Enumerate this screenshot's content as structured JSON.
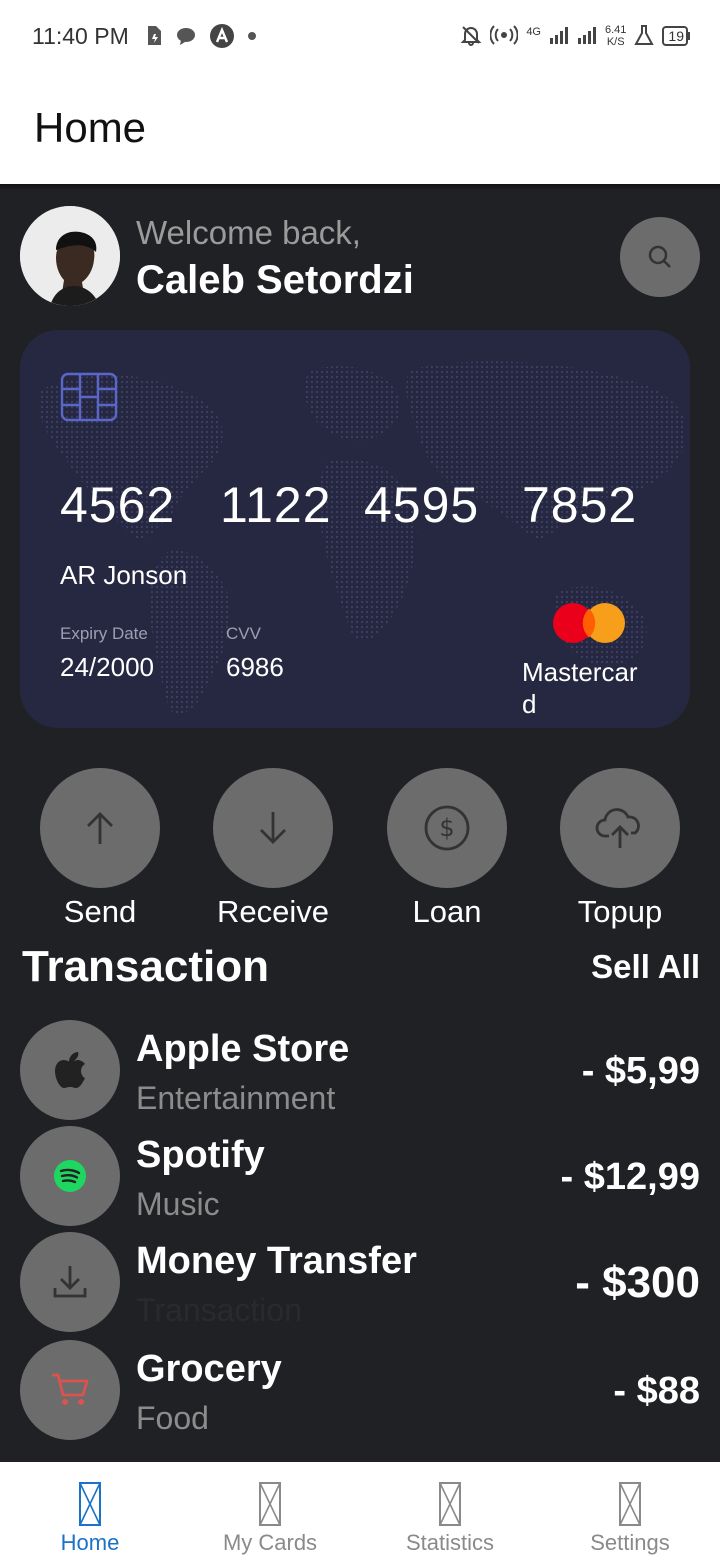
{
  "status_bar": {
    "time": "11:40 PM",
    "network_speed_value": "6.41",
    "network_speed_unit": "K/S",
    "network_type": "4G",
    "battery": "19"
  },
  "app_bar": {
    "title": "Home"
  },
  "welcome": {
    "subtitle": "Welcome back,",
    "name": "Caleb Setordzi"
  },
  "card": {
    "number_groups": [
      "4562",
      "1122",
      "4595",
      "7852"
    ],
    "holder": "AR Jonson",
    "expiry_label": "Expiry Date",
    "expiry_value": "24/2000",
    "cvv_label": "CVV",
    "cvv_value": "6986",
    "brand": "Mastercard",
    "colors": {
      "background": "#262842",
      "mc_red": "#eb001b",
      "mc_orange": "#f79e1b"
    }
  },
  "actions": [
    {
      "label": "Send",
      "icon": "arrow-up-icon"
    },
    {
      "label": "Receive",
      "icon": "arrow-down-icon"
    },
    {
      "label": "Loan",
      "icon": "dollar-circle-icon"
    },
    {
      "label": "Topup",
      "icon": "cloud-upload-icon"
    }
  ],
  "transactions": {
    "title": "Transaction",
    "see_all": "Sell All",
    "items": [
      {
        "name": "Apple Store",
        "category": "Entertainment",
        "amount": "- $5,99",
        "icon": "apple-icon"
      },
      {
        "name": "Spotify",
        "category": "Music",
        "amount": "- $12,99",
        "icon": "spotify-icon"
      },
      {
        "name": "Money Transfer",
        "category": "Transaction",
        "amount": "- $300",
        "icon": "download-icon"
      },
      {
        "name": "Grocery",
        "category": "Food",
        "amount": "- $88",
        "icon": "cart-icon"
      }
    ]
  },
  "bottom_nav": {
    "items": [
      {
        "label": "Home",
        "active": true
      },
      {
        "label": "My Cards",
        "active": false
      },
      {
        "label": "Statistics",
        "active": false
      },
      {
        "label": "Settings",
        "active": false
      }
    ],
    "active_color": "#1a73c8"
  }
}
